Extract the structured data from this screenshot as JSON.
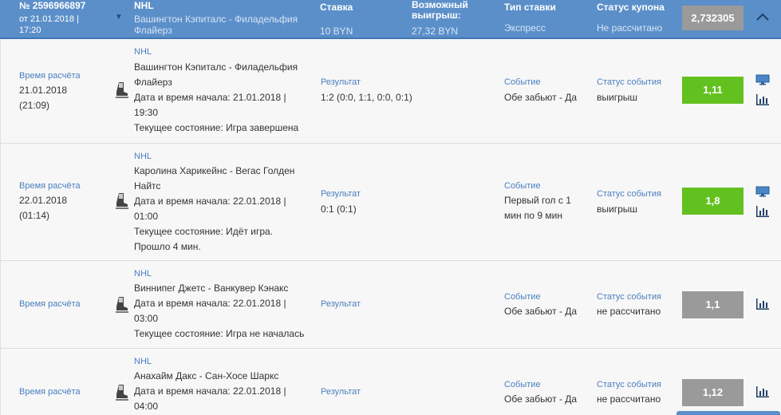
{
  "header": {
    "coupon_id": "№ 2596966897",
    "date": "от 21.01.2018 |",
    "time": "17:20",
    "league": "NHL",
    "match": "Вашингтон Кэпиталс - Филадельфия Флайерз",
    "stake_label": "Ставка",
    "stake_value": "10 BYN",
    "winnings_label": "Возможный выигрыш:",
    "winnings_value": "27,32 BYN",
    "bet_type_label": "Тип ставки",
    "bet_type_value": "Экспресс",
    "status_label": "Статус купона",
    "status_value": "Не рассчитано",
    "total_coef": "2,732305"
  },
  "labels": {
    "calc_time": "Время расчёта",
    "result": "Результат",
    "event": "Событие",
    "event_status": "Статус события"
  },
  "rows": [
    {
      "calc_date": "21.01.2018",
      "calc_time": "(21:09)",
      "league": "NHL",
      "match_line1": "Вашингтон Кэпиталс - Филадельфия",
      "match_line2": "Флайерз",
      "start_line1": "Дата и время начала: 21.01.2018 |",
      "start_line2": "19:30",
      "state_line1": "Текущее состояние: Игра завершена",
      "result": "1:2 (0:0, 1:1, 0:0, 0:1)",
      "event_line1": "Обе забьют - Да",
      "event_status": "выигрыш",
      "coef": "1,11"
    },
    {
      "calc_date": "22.01.2018",
      "calc_time": "(01:14)",
      "league": "NHL",
      "match_line1": "Каролина Харикейнс - Вегас Голден",
      "match_line2": "Найтс",
      "start_line1": "Дата и время начала: 22.01.2018 |",
      "start_line2": "01:00",
      "state_line1": "Текущее состояние: Идёт игра.",
      "state_line2": "Прошло 4 мин.",
      "result": "0:1 (0:1)",
      "event_line1": "Первый гол с 1",
      "event_line2": "мин по 9 мин",
      "event_status": "выигрыш",
      "coef": "1,8"
    },
    {
      "league": "NHL",
      "match_line1": "Виннипег Джетс - Ванкувер Кэнакс",
      "start_line1": "Дата и время начала: 22.01.2018 |",
      "start_line2": "03:00",
      "state_line1": "Текущее состояние: Игра не началась",
      "event_line1": "Обе забьют - Да",
      "event_status": "не рассчитано",
      "coef": "1,1"
    },
    {
      "league": "NHL",
      "match_line1": "Анахайм Дакс - Сан-Хосе Шаркс",
      "start_line1": "Дата и время начала: 22.01.2018 |",
      "start_line2": "04:00",
      "event_line1": "Обе забьют - Да",
      "event_status": "не рассчитано",
      "coef": "1,12"
    }
  ],
  "icons": [
    "hockey-skate-icon",
    "monitor-icon",
    "bar-chart-icon",
    "chevron-up-icon",
    "caret-down-icon"
  ],
  "colors": {
    "header": "#5b8fc9",
    "win": "#63c11f",
    "pending": "#9a9a9a",
    "label": "#4a7fbf"
  }
}
